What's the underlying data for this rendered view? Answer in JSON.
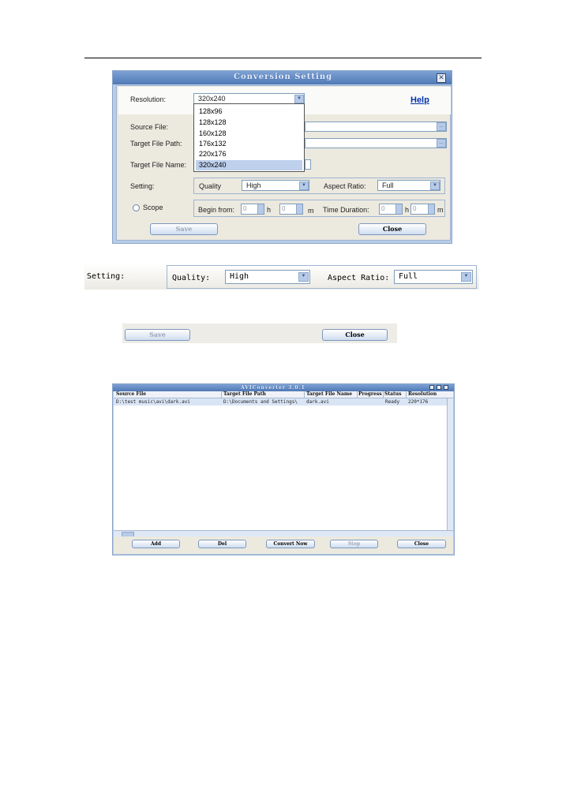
{
  "conversion_window": {
    "title": "Conversion Setting",
    "resolution_label": "Resolution:",
    "resolution_value": "320x240",
    "help_label": "Help",
    "resolution_options": [
      "128x96",
      "128x128",
      "160x128",
      "176x132",
      "220x176",
      "320x240"
    ],
    "selected_option": "320x240",
    "source_file_label": "Source File:",
    "target_path_label": "Target File Path:",
    "target_name_label": "Target File Name:",
    "setting_label": "Setting:",
    "quality_label": "Quality",
    "quality_value": "High",
    "aspect_label": "Aspect Ratio:",
    "aspect_value": "Full",
    "scope_label": "Scope",
    "begin_label": "Begin from:",
    "begin_h": "0",
    "h_unit": "h",
    "begin_m": "0",
    "m_unit": "m",
    "duration_label": "Time Duration:",
    "duration_h": "0",
    "duration_m": "0",
    "save_label": "Save",
    "close_label": "Close"
  },
  "setting_strip": {
    "setting_label": "Setting:",
    "quality_label": "Quality:",
    "quality_value": "High",
    "aspect_label": "Aspect Ratio:",
    "aspect_value": "Full"
  },
  "button_strip": {
    "save_label": "Save",
    "close_label": "Close"
  },
  "converter_window": {
    "title": "AVIConverter 3.0.1",
    "columns": [
      "Source File",
      "Target File Path",
      "Target File Name",
      "Progress",
      "Status",
      "Resolution"
    ],
    "rows": [
      {
        "source": "D:\\test music\\avi\\dark.avi",
        "target_path": "D:\\Documents and Settings\\",
        "target_name": "dark.avi",
        "progress": "",
        "status": "Ready",
        "resolution": "220*176"
      }
    ],
    "buttons": {
      "add": "Add",
      "del": "Del",
      "convert": "Convert Now",
      "stop": "Stop",
      "close": "Close"
    }
  }
}
